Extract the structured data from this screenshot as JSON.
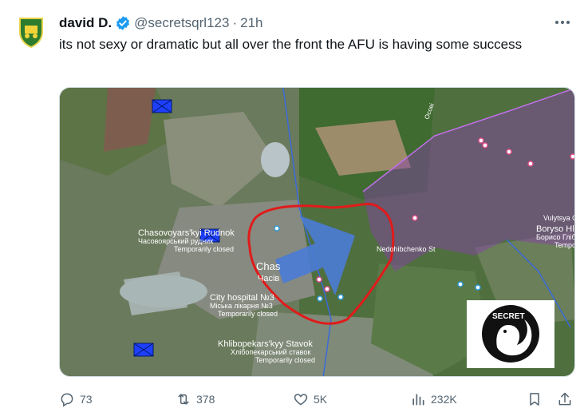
{
  "author": {
    "name": "david D.",
    "handle": "@secretsqrl123",
    "separator": "·",
    "time": "21h"
  },
  "tweet": {
    "text": "its not sexy or dramatic but all over the front the AFU is having some success"
  },
  "map": {
    "labels": {
      "chasovoyars_en": "Chasovoyars'kyi Rudnok",
      "chasovoyars_ua": "Часовоярський рудник",
      "chasovoyars_status": "Temporarily closed",
      "chasiv_short_en": "Chas",
      "chasiv_short_ua": "Часів",
      "hospital_en": "City hospital №3",
      "hospital_ua": "Міська лікарня №3",
      "hospital_status": "Temporarily closed",
      "khlibopekars_en": "Khlibopekars'kyy Stavok",
      "khlibopekars_ua": "Хлібопекарський ставок",
      "khlibopekars_status": "Temporarily closed",
      "street": "Nedohibchenko St",
      "road": "Осові",
      "vulytsya": "Vulytsya O",
      "borysohlibs_en": "Boryso Hlibs'k",
      "borysohlibs_ua": "Борисо Глібс",
      "borysohlibs_status": "Tempo",
      "logo_text": "SECRET"
    },
    "colors": {
      "attack_arrow": "#4a7bd6",
      "front_line": "#e01b1b",
      "occupied_overlay": "#8a3fb0",
      "unit_marker": "#1f3fff"
    }
  },
  "actions": {
    "replies": "73",
    "reposts": "378",
    "likes": "5K",
    "views": "232K"
  }
}
